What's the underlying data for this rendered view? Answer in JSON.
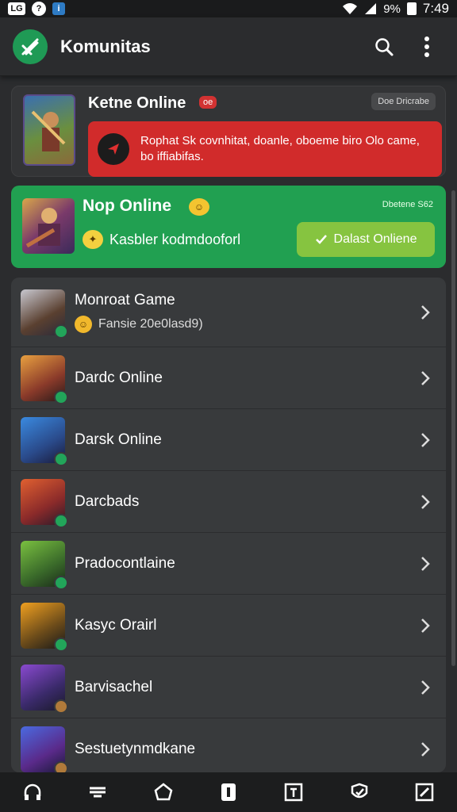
{
  "status_bar": {
    "left_icons": [
      "lb-icon",
      "status-dot-icon",
      "app-badge-icon"
    ],
    "left_labels": [
      "LG",
      "?",
      "i"
    ],
    "signal": "9%",
    "time": "7:49"
  },
  "app_bar": {
    "title": "Komunitas"
  },
  "featured_offline": {
    "title": "Ketne Online",
    "badge": "oe",
    "pill": "Doe Dricrabe",
    "alert_text": "Rophat Sk covnhitat, doanle, oboeme biro Olo came, bo iffiabifas."
  },
  "featured_online": {
    "title": "Nop Online",
    "pill": "Dbetene S62",
    "sub": "Kasbler kodmdooforl",
    "button": "Dalast Onliene"
  },
  "games": [
    {
      "title": "Monroat Game",
      "sub": "Fansie 20e0lasd9)"
    },
    {
      "title": "Dardc Online",
      "sub": ""
    },
    {
      "title": "Darsk Online",
      "sub": ""
    },
    {
      "title": "Darcbads",
      "sub": ""
    },
    {
      "title": "Pradocontlaine",
      "sub": ""
    },
    {
      "title": "Kasyc Orairl",
      "sub": ""
    },
    {
      "title": "Barvisachel",
      "sub": ""
    },
    {
      "title": "Sestuetynmdkane",
      "sub": ""
    }
  ],
  "colors": {
    "brand": "#1f9a55",
    "alert": "#d12b2b",
    "online_card": "#21a051",
    "button": "#86c440"
  },
  "bottom_nav": [
    "headset-icon",
    "layers-icon",
    "chat-icon",
    "info-icon",
    "grid-icon",
    "shield-icon",
    "edit-icon"
  ]
}
